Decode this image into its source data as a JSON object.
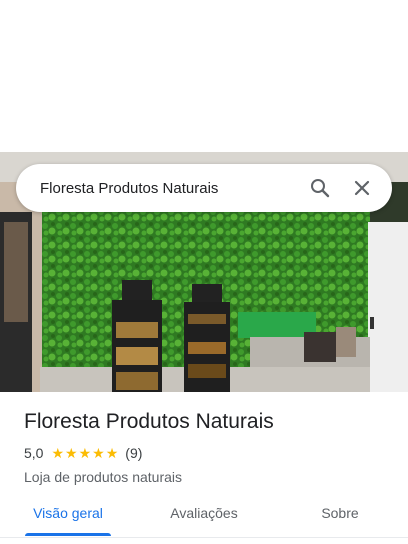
{
  "search": {
    "query": "Floresta Produtos Naturais"
  },
  "place": {
    "name": "Floresta Produtos Naturais",
    "rating": "5,0",
    "stars": 5,
    "review_count": "(9)",
    "category": "Loja de produtos naturais"
  },
  "tabs": [
    {
      "label": "Visão geral",
      "active": true
    },
    {
      "label": "Avaliações",
      "active": false
    },
    {
      "label": "Sobre",
      "active": false
    }
  ],
  "colors": {
    "accent": "#1a73e8",
    "star": "#fbbc04",
    "text_primary": "#202124",
    "text_secondary": "#5f6368"
  },
  "icons": {
    "search": "search-icon",
    "close": "close-icon",
    "star": "star-icon"
  }
}
